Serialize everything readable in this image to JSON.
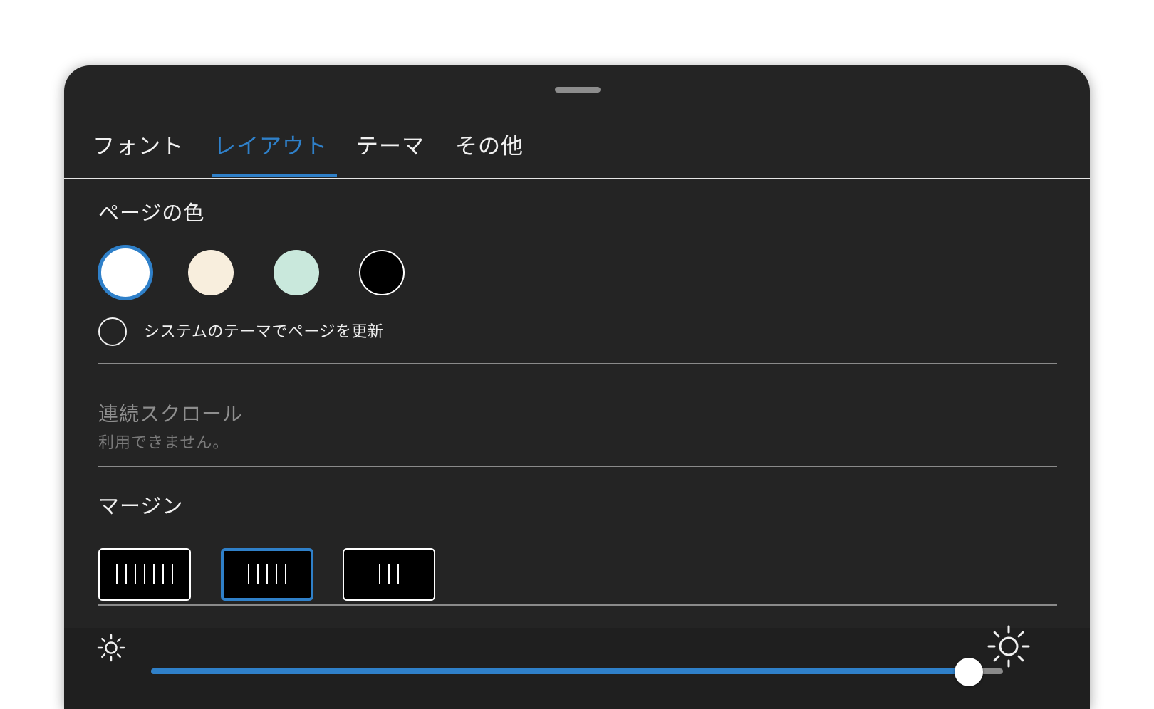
{
  "tabs": [
    {
      "label": "フォント",
      "active": false
    },
    {
      "label": "レイアウト",
      "active": true
    },
    {
      "label": "テーマ",
      "active": false
    },
    {
      "label": "その他",
      "active": false
    }
  ],
  "page_color": {
    "title": "ページの色",
    "swatches": [
      {
        "color": "#ffffff",
        "selected": true
      },
      {
        "color": "#f8eedd",
        "selected": false
      },
      {
        "color": "#c9e8dc",
        "selected": false
      },
      {
        "color": "#000000",
        "selected": false
      }
    ],
    "system_theme_label": "システムのテーマでページを更新",
    "system_theme_checked": false
  },
  "continuous_scroll": {
    "title": "連続スクロール",
    "subtitle": "利用できません。"
  },
  "margin": {
    "title": "マージン",
    "options": [
      {
        "bars": 7,
        "selected": false
      },
      {
        "bars": 5,
        "selected": true
      },
      {
        "bars": 3,
        "selected": false
      }
    ]
  },
  "brightness": {
    "value": 0.96,
    "low_icon": "sun-small-icon",
    "high_icon": "sun-large-icon"
  },
  "colors": {
    "accent": "#2f80c9",
    "panel": "#242424"
  }
}
